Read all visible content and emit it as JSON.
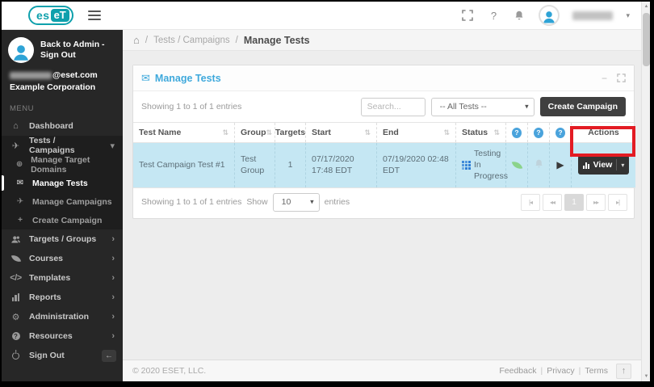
{
  "brand": {
    "logo_part1": "es",
    "logo_part2": "eT",
    "teal": "#0ea0ac"
  },
  "topbar": {
    "help": "?"
  },
  "breadcrumb": {
    "sep1": "/",
    "section": "Tests / Campaigns",
    "sep2": "/",
    "current": "Manage Tests"
  },
  "sidebar": {
    "back_link": "Back to Admin - Sign Out",
    "email_suffix": "@eset.com",
    "company": "Example Corporation",
    "menu_label": "MENU",
    "dashboard": "Dashboard",
    "tests_campaigns": "Tests / Campaigns",
    "sub_manage_target_domains": "Manage Target Domains",
    "sub_manage_tests": "Manage Tests",
    "sub_manage_campaigns": "Manage Campaigns",
    "sub_create_campaign": "Create Campaign",
    "targets_groups": "Targets / Groups",
    "courses": "Courses",
    "templates": "Templates",
    "reports": "Reports",
    "administration": "Administration",
    "resources": "Resources",
    "sign_out": "Sign Out"
  },
  "panel": {
    "title": "Manage Tests",
    "showing_top": "Showing 1 to 1 of 1 entries",
    "search_placeholder": "Search...",
    "filter_selected": "-- All Tests --",
    "create_campaign": "Create Campaign",
    "headers": {
      "test_name": "Test Name",
      "group": "Group",
      "targets": "Targets",
      "start": "Start",
      "end": "End",
      "status": "Status",
      "actions": "Actions"
    },
    "row": {
      "test_name": "Test Campaign Test #1",
      "group": "Test Group",
      "targets": "1",
      "start": "07/17/2020 17:48 EDT",
      "end": "07/19/2020 02:48 EDT",
      "status": "Testing In Progress"
    },
    "view_button": "View",
    "showing_bottom": "Showing 1 to 1 of 1 entries",
    "show_label": "Show",
    "page_size": "10",
    "entries_label": "entries",
    "current_page": "1"
  },
  "footer": {
    "copyright": "© 2020 ESET, LLC.",
    "feedback": "Feedback",
    "privacy": "Privacy",
    "terms": "Terms",
    "sep": "|"
  },
  "icons": {
    "help": "?",
    "caret_down": "▾",
    "chevron_right": "›",
    "chevron_down": "▾",
    "sort": "⇅",
    "home": "⌂",
    "envelope": "✉",
    "globe": "⊕",
    "send": "✈",
    "plus": "+",
    "gear": "⚙",
    "code": "</>",
    "play": "▶",
    "minus": "−",
    "up_arrow": "↑",
    "left_arrow": "←",
    "scroll_up": "▲",
    "scroll_down": "▼",
    "pag_first": "|◂",
    "pag_prev": "◂◂",
    "pag_next": "▸▸",
    "pag_last": "▸|"
  },
  "colors": {
    "accent_blue": "#3fa9dc",
    "row_highlight": "#c5e7f3",
    "sidebar_bg": "#272727",
    "button_dark": "#404040",
    "annotation_red": "#e31b23",
    "status_blue": "#2f7fd6",
    "leaf_green": "#8bd38b"
  }
}
